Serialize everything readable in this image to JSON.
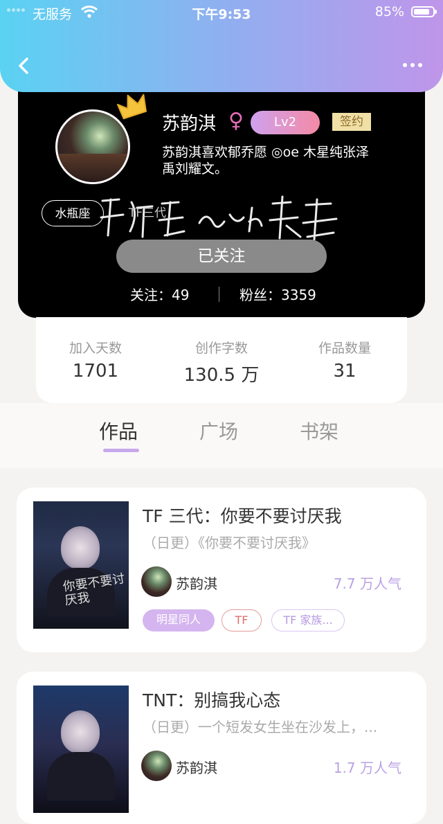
{
  "status_bar": {
    "carrier": "无服务",
    "time": "下午9:53",
    "battery": "85%",
    "battery_level": 0.85
  },
  "profile": {
    "name": "苏韵淇",
    "gender_symbol": "♀",
    "level": "Lv2",
    "signed_badge": "签约",
    "bio": "苏韵淇喜欢郁乔愿 ◎oe 木星纯张泽禹刘耀文。",
    "tags": [
      "水瓶座",
      "TF三代"
    ],
    "follow_button": "已关注",
    "following_label": "关注：49",
    "fans_label": "粉丝：3359"
  },
  "metrics": [
    {
      "label": "加入天数",
      "value": "1701"
    },
    {
      "label": "创作字数",
      "value": "130.5 万"
    },
    {
      "label": "作品数量",
      "value": "31"
    }
  ],
  "tabs": [
    {
      "label": "作品",
      "active": true
    },
    {
      "label": "广场",
      "active": false
    },
    {
      "label": "书架",
      "active": false
    }
  ],
  "books": [
    {
      "title": "TF 三代：你要不要讨厌我",
      "description": "（日更）《你要不要讨厌我》",
      "author": "苏韵淇",
      "popularity": "7.7 万人气",
      "cover_title": "你要不要讨厌我",
      "tags": [
        "明星同人",
        "TF",
        "TF 家族..."
      ]
    },
    {
      "title": "TNT：别搞我心态",
      "description": "（日更）一个短发女生坐在沙发上，...",
      "author": "苏韵淇",
      "popularity": "1.7 万人气"
    }
  ],
  "colors": {
    "header_gradient": [
      "#5ad2f2",
      "#bf95ea"
    ],
    "level_badge": "#cfa1ee",
    "accent": "#c7a8ea",
    "popularity": "#b9a1e4"
  },
  "icons": [
    "signal-icon",
    "wifi-icon",
    "battery-icon",
    "back-icon",
    "more-icon",
    "crown-icon"
  ]
}
